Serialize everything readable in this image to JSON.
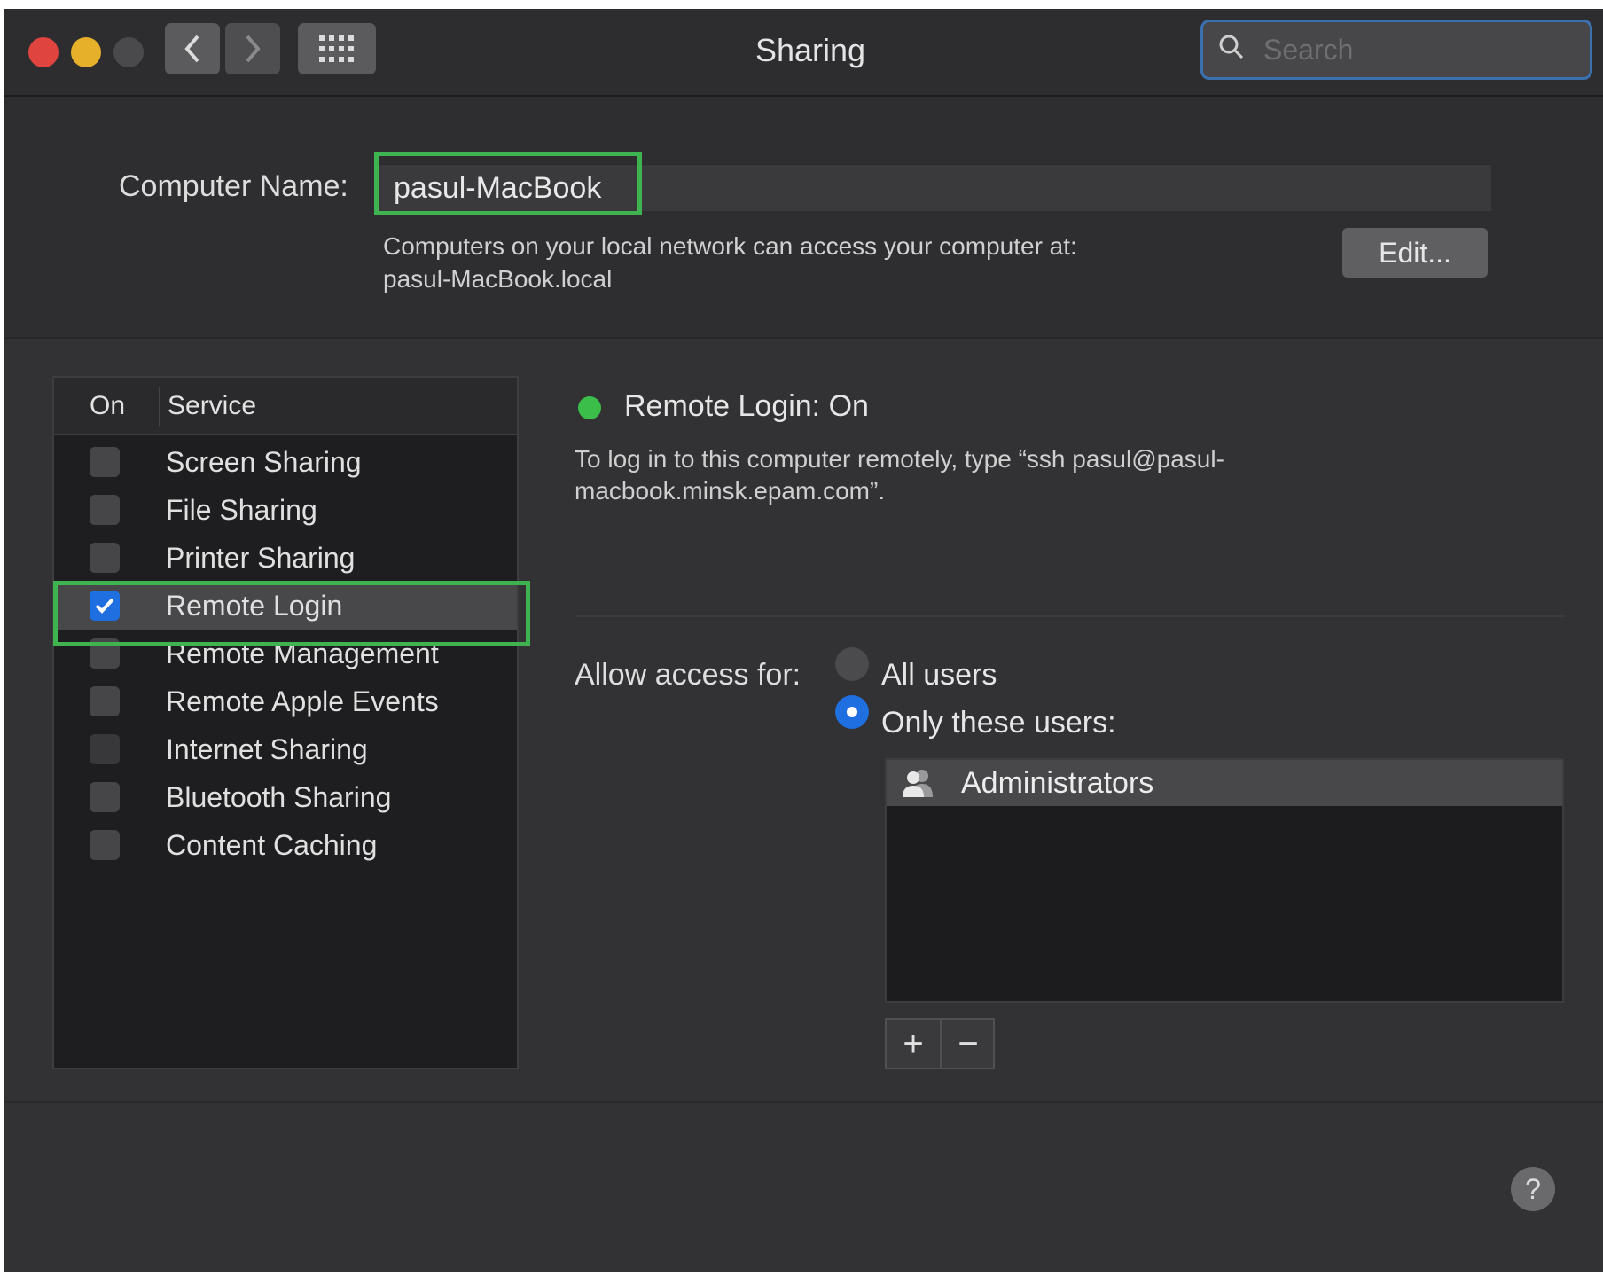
{
  "window": {
    "title": "Sharing",
    "search_placeholder": "Search",
    "grid_icon": "grid-icon",
    "back_icon": "chevron-left-icon",
    "forward_icon": "chevron-right-icon"
  },
  "computer_name": {
    "label": "Computer Name:",
    "value": "pasul-MacBook",
    "description_line1": "Computers on your local network can access your computer at:",
    "description_line2": "pasul-MacBook.local",
    "edit_label": "Edit..."
  },
  "services": {
    "col_on": "On",
    "col_service": "Service",
    "items": [
      {
        "label": "Screen Sharing",
        "checked": false
      },
      {
        "label": "File Sharing",
        "checked": false
      },
      {
        "label": "Printer Sharing",
        "checked": false
      },
      {
        "label": "Remote Login",
        "checked": true
      },
      {
        "label": "Remote Management",
        "checked": false
      },
      {
        "label": "Remote Apple Events",
        "checked": false
      },
      {
        "label": "Internet Sharing",
        "checked": false
      },
      {
        "label": "Bluetooth Sharing",
        "checked": false
      },
      {
        "label": "Content Caching",
        "checked": false
      }
    ]
  },
  "detail": {
    "status": "Remote Login: On",
    "status_color": "#3cbf4a",
    "description_line1": "To log in to this computer remotely, type “ssh pasul@pasul-",
    "description_line2": "macbook.minsk.epam.com”.",
    "allow_label": "Allow access for:",
    "radio_all": "All users",
    "radio_only": "Only these users:",
    "selected_radio": "only",
    "users": [
      "Administrators"
    ],
    "add_label": "+",
    "remove_label": "−"
  },
  "colors": {
    "highlight": "#3fb34f",
    "accent": "#1f6fe0"
  },
  "help_label": "?"
}
